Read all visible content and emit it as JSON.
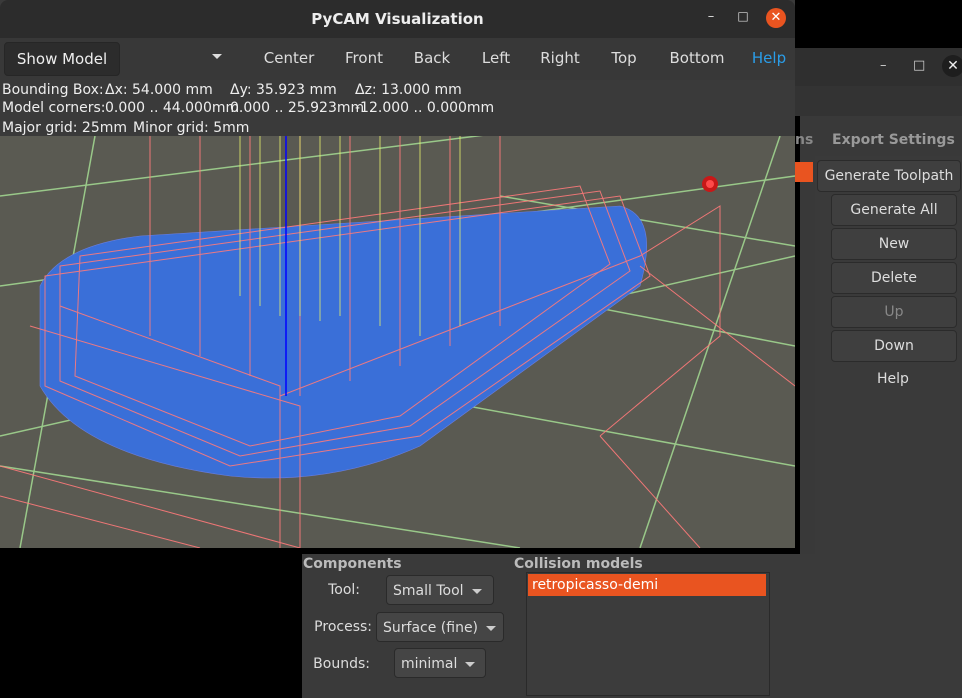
{
  "window": {
    "title": "PyCAM Visualization",
    "minimize": "–",
    "maximize": "□",
    "close": "✕"
  },
  "toolbar": {
    "show_model": "Show Model",
    "views": [
      "Center",
      "Front",
      "Back",
      "Left",
      "Right",
      "Top",
      "Bottom"
    ],
    "help": "Help"
  },
  "info": {
    "bbox_label": "Bounding Box:",
    "dx": "Δx: 54.000 mm",
    "dy": "Δy: 35.923 mm",
    "dz": "Δz: 13.000 mm",
    "corners_label": "Model corners:",
    "corners_x": "0.000 .. 44.000mm",
    "corners_y": "0.000 .. 25.923mm",
    "corners_z": "-12.000 .. 0.000mm",
    "major_grid": "Major grid: 25mm",
    "minor_grid": "Minor grid: 5mm"
  },
  "back_window": {
    "tab_partial": "ns",
    "tab_export": "Export Settings",
    "buttons": {
      "generate_toolpath": "Generate Toolpath",
      "generate_all": "Generate All",
      "new": "New",
      "delete": "Delete",
      "up": "Up",
      "down": "Down",
      "help": "Help"
    }
  },
  "components": {
    "title": "Components",
    "tool_label": "Tool:",
    "tool_value": "Small Tool",
    "process_label": "Process:",
    "process_value": "Surface (fine)",
    "bounds_label": "Bounds:",
    "bounds_value": "minimal"
  },
  "collision": {
    "title": "Collision models",
    "items": [
      "retropicasso-demi"
    ]
  },
  "colors": {
    "accent": "#e95420",
    "link": "#2a9de8",
    "toolpath": "#ff7a7a",
    "model": "#3a6fd8",
    "grid": "#9fd890",
    "axis_z": "#0000ff"
  }
}
